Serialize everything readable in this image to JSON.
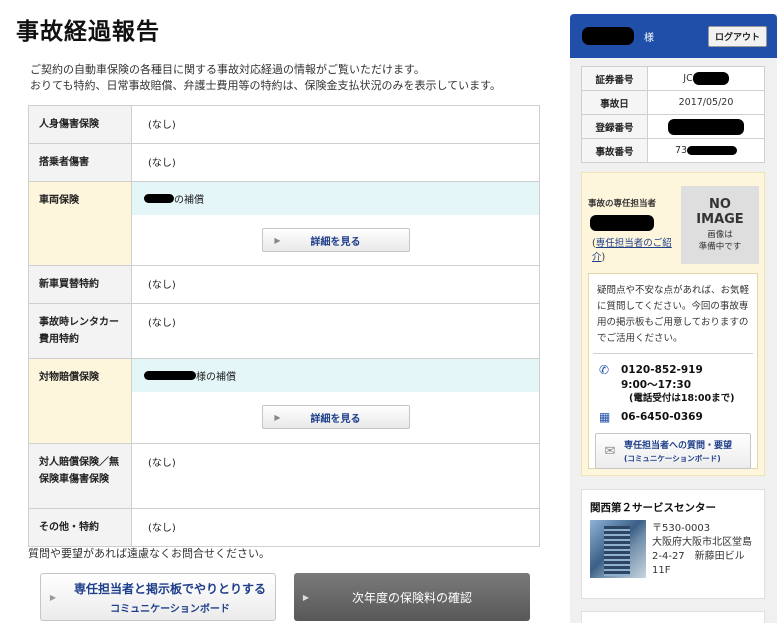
{
  "page": {
    "title": "事故経過報告",
    "intro": [
      "ご契約の自動車保険の各種目に関する事故対応経過の情報がご覧いただけます。",
      "おりても特約、日常事故賠償、弁護士費用等の特約は、保険金支払状況のみを表示しています。"
    ]
  },
  "coverage": {
    "rows": [
      {
        "label": "人身傷害保険",
        "value": "(なし)"
      },
      {
        "label": "搭乗者傷害",
        "value": "(なし)"
      },
      {
        "label": "車両保険",
        "value_suffix": "の補償",
        "button": "詳細を見る"
      },
      {
        "label": "新車買替特約",
        "value": "(なし)"
      },
      {
        "label": "事故時レンタカー費用特約",
        "value": "(なし)"
      },
      {
        "label": "対物賠償保険",
        "value_suffix": "様の補償",
        "button": "詳細を見る"
      },
      {
        "label": "対人賠償保険／無保険車傷害保険",
        "value": "(なし)"
      },
      {
        "label": "その他・特約",
        "value": "(なし)"
      }
    ]
  },
  "footer": {
    "inquiry": "質問や要望があれば遠慮なくお問合せください。",
    "board_button": {
      "line1": "専任担当者と掲示板でやりとりする",
      "line2": "コミュニケーションボード"
    },
    "renew_button": "次年度の保険料の確認"
  },
  "sidebar": {
    "honorific": "様",
    "logout": "ログアウト",
    "info": [
      {
        "key": "証券番号",
        "value": "JC"
      },
      {
        "key": "事故日",
        "value": "2017/05/20"
      },
      {
        "key": "登録番号",
        "value": ""
      },
      {
        "key": "事故番号",
        "value": "73"
      }
    ],
    "staff": {
      "label": "事故の専任担当者",
      "link_open": "(",
      "link": "専任担当者のご紹介",
      "link_close": ")",
      "noimage_line1": "NO",
      "noimage_line2": "IMAGE",
      "noimage_line3": "画像は",
      "noimage_line4": "準備中です",
      "message": "疑問点や不安な点があれば、お気軽に質問してください。今回の事故専用の掲示板もご用意しておりますのでご活用ください。",
      "phone": "0120-852-919",
      "hours": "9:00〜17:30",
      "hours_note": "(電話受付は18:00まで)",
      "fax": "06-6450-0369",
      "msg_button_line1": "専任担当者への質問・要望",
      "msg_button_line2": "(コミュニケーションボード)"
    },
    "center": {
      "title": "関西第２サービスセンター",
      "postal": "〒530-0003",
      "address1": "大阪府大阪市北区堂島",
      "address2": "2-4-27　新藤田ビル",
      "address3": "11F"
    }
  }
}
